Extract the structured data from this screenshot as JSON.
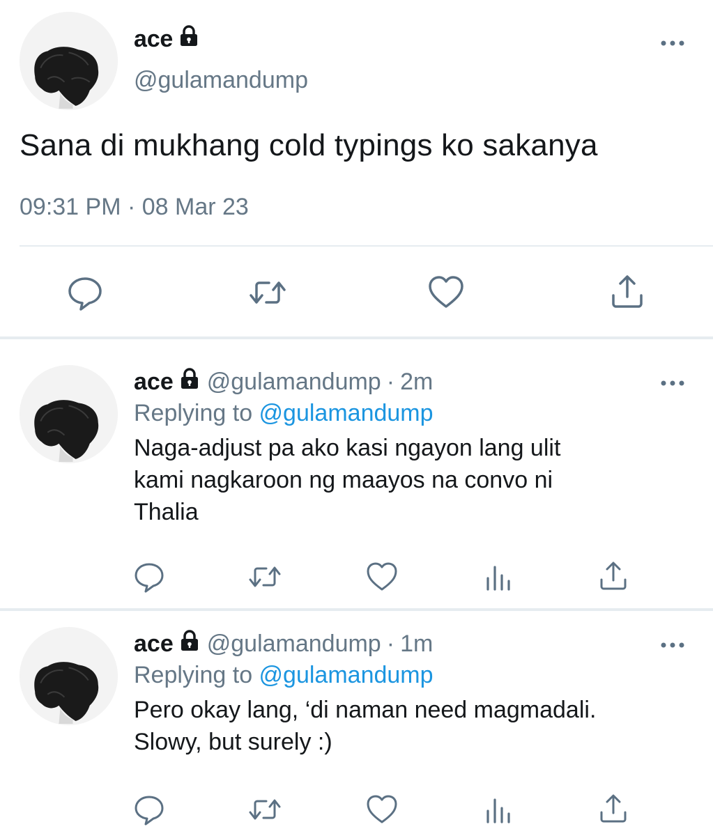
{
  "main_tweet": {
    "display_name": "ace",
    "handle": "@gulamandump",
    "text": "Sana di mukhang cold typings ko sakanya",
    "timestamp": "09:31 PM · 08 Mar 23",
    "actions": [
      "reply-icon",
      "retweet-icon",
      "like-icon",
      "share-icon"
    ]
  },
  "replies": [
    {
      "display_name": "ace",
      "handle": "@gulamandump",
      "separator": "·",
      "age": "2m",
      "replying_prefix": "Replying to",
      "replying_to": "@gulamandump",
      "text_lines": [
        "Naga-adjust pa ako kasi ngayon lang ulit",
        "kami nagkaroon ng maayos na convo ni",
        "Thalia"
      ],
      "actions": [
        "reply-icon",
        "retweet-icon",
        "like-icon",
        "analytics-icon",
        "share-icon"
      ]
    },
    {
      "display_name": "ace",
      "handle": "@gulamandump",
      "separator": "·",
      "age": "1m",
      "replying_prefix": "Replying to",
      "replying_to": "@gulamandump",
      "text_lines": [
        "Pero okay lang, ‘di naman need magmadali.",
        "Slowy, but surely :)"
      ],
      "actions": [
        "reply-icon",
        "retweet-icon",
        "like-icon",
        "analytics-icon",
        "share-icon"
      ]
    }
  ],
  "colors": {
    "text": "#14171a",
    "secondary": "#657786",
    "link": "#1b95e0",
    "divider": "#e6ecf0",
    "icon": "#5b7083"
  }
}
